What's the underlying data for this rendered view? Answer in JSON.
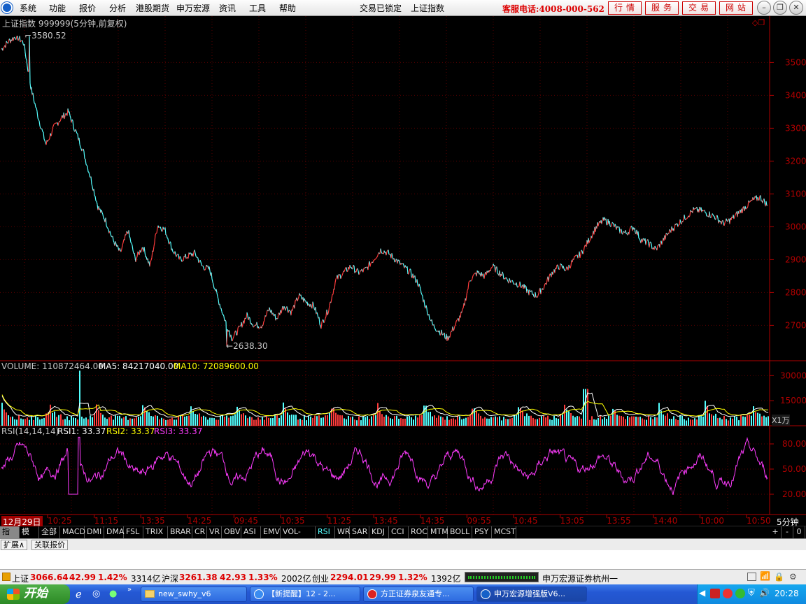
{
  "menu": {
    "items": [
      "系统",
      "功能",
      "报价",
      "分析",
      "港股期货",
      "申万宏源",
      "资讯",
      "工具",
      "帮助"
    ],
    "status_lock": "交易已锁定",
    "current_index": "上证指数",
    "hotline": "客服电话:4008-000-562",
    "right_buttons": [
      "行情",
      "服务",
      "交易",
      "网站"
    ]
  },
  "chart_header": {
    "title": "上证指数 999999(5分钟,前复权)",
    "high_label": "3580.52",
    "low_label": "2638.30"
  },
  "volume_header": {
    "label": "VOLUME: 110872464.00",
    "ma5": "MA5: 84217040.00",
    "ma10": "MA10: 72089600.00",
    "unit": "X1万"
  },
  "rsi_header": {
    "label": "RSI(14,14,14)",
    "rsi1": "RSI1: 33.37",
    "rsi2": "RSI2: 33.37",
    "rsi3": "RSI3: 33.37"
  },
  "time_axis": {
    "date_label": "12月29日",
    "period_label": "5分钟",
    "ticks": [
      "10:25",
      "11:15",
      "13:35",
      "14:25",
      "09:45",
      "10:35",
      "11:25",
      "13:45",
      "14:35",
      "09:55",
      "10:45",
      "13:05",
      "13:55",
      "14:40",
      "10:00",
      "10:50"
    ]
  },
  "tabs": [
    "指标",
    "模板",
    "全部",
    "MACD",
    "DMI",
    "DMA",
    "FSL",
    "TRIX",
    "BRAR",
    "CR",
    "VR",
    "OBV",
    "ASI",
    "EMV",
    "VOL-TDX",
    "RSI",
    "WR",
    "SAR",
    "KDJ",
    "CCI",
    "ROC",
    "MTM",
    "BOLL",
    "PSY",
    "MCST"
  ],
  "tab_controls": [
    "+",
    "-",
    "0"
  ],
  "subtabs": [
    "扩展∧",
    "关联报价"
  ],
  "statusbar": {
    "sh_name": "上证",
    "sh_value": "3066.64",
    "sh_change": "42.99",
    "sh_pct": "1.42%",
    "sh_amount": "3314亿",
    "hs_name": "沪深",
    "hs_value": "3261.38",
    "hs_change": "42.93",
    "hs_pct": "1.33%",
    "hs_amount": "2002亿",
    "cy_name": "创业",
    "cy_value": "2294.01",
    "cy_change": "29.99",
    "cy_pct": "1.32%",
    "cy_amount": "1392亿",
    "broker": "申万宏源证券杭州一"
  },
  "taskbar": {
    "start": "开始",
    "tasks": [
      "new_swhy_v6",
      "【新提醒】12 - 2...",
      "方正证券泉友通专...",
      "申万宏源增强版V6..."
    ],
    "clock": "20:28"
  },
  "colors": {
    "up": "#ff3c3c",
    "down": "#54ffff",
    "rsi": "#ff3cff",
    "axis": "#b00000",
    "text": "#c0c0c0",
    "vol_ma5": "#ffffff",
    "vol_ma10": "#ffff00"
  },
  "chart_data": [
    {
      "type": "line",
      "title": "上证指数 999999(5分钟,前复权)",
      "y_ticks": [
        2700,
        2800,
        2900,
        3000,
        3100,
        3200,
        3300,
        3400,
        3500
      ],
      "ylim": [
        2620,
        3620
      ],
      "x": [
        "12月29日",
        "10:25",
        "11:15",
        "13:35",
        "14:25",
        "09:45",
        "10:35",
        "11:25",
        "13:45",
        "14:35",
        "09:55",
        "10:45",
        "13:05",
        "13:55",
        "14:40",
        "10:00",
        "10:50"
      ],
      "anchors": [
        3540,
        3565,
        3580,
        3560,
        3420,
        3330,
        3250,
        3300,
        3330,
        3350,
        3290,
        3230,
        3150,
        3060,
        3020,
        2960,
        2920,
        2990,
        2900,
        2940,
        2880,
        3005,
        2990,
        2930,
        2900,
        2910,
        2920,
        2880,
        2870,
        2790,
        2720,
        2660,
        2690,
        2730,
        2700,
        2700,
        2750,
        2720,
        2760,
        2740,
        2790,
        2770,
        2760,
        2700,
        2750,
        2840,
        2860,
        2880,
        2860,
        2870,
        2900,
        2930,
        2920,
        2900,
        2880,
        2860,
        2830,
        2760,
        2700,
        2680,
        2660,
        2700,
        2740,
        2840,
        2860,
        2850,
        2880,
        2860,
        2840,
        2830,
        2820,
        2800,
        2790,
        2820,
        2860,
        2880,
        2870,
        2900,
        2920,
        2960,
        3000,
        3020,
        3010,
        2990,
        2980,
        3000,
        2960,
        2950,
        2930,
        2960,
        2990,
        3010,
        3030,
        3050,
        3050,
        3040,
        3030,
        3010,
        3020,
        3040,
        3060,
        3080,
        3090,
        3066
      ],
      "high": 3580.52,
      "low": 2638.3,
      "last": 3066.64
    },
    {
      "type": "bar",
      "title": "VOLUME",
      "y_ticks": [
        15000,
        30000
      ],
      "ylim": [
        0,
        36000
      ],
      "series": [
        {
          "name": "VOLUME",
          "last": 110872464
        },
        {
          "name": "MA5",
          "last": 84217040
        },
        {
          "name": "MA10",
          "last": 72089600
        }
      ]
    },
    {
      "type": "line",
      "title": "RSI(14,14,14)",
      "y_ticks": [
        20,
        50,
        80
      ],
      "ylim": [
        0,
        100
      ],
      "series": [
        {
          "name": "RSI1",
          "last": 33.37
        },
        {
          "name": "RSI2",
          "last": 33.37
        },
        {
          "name": "RSI3",
          "last": 33.37
        }
      ]
    }
  ]
}
